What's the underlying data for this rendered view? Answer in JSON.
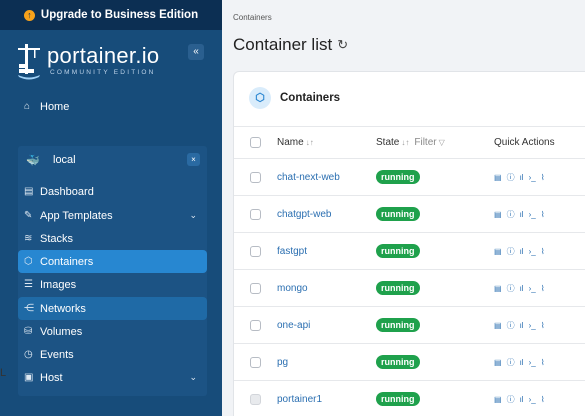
{
  "upgrade": {
    "label": "Upgrade to Business Edition"
  },
  "logo": {
    "name": "portainer.io",
    "edition": "COMMUNITY EDITION"
  },
  "sidebar": {
    "collapse": "«",
    "home": "Home",
    "environment": {
      "name": "local",
      "close": "×"
    },
    "items": [
      {
        "label": "Dashboard",
        "icon": "dashboard-icon"
      },
      {
        "label": "App Templates",
        "icon": "edit-icon"
      },
      {
        "label": "Stacks",
        "icon": "stacks-icon"
      },
      {
        "label": "Containers",
        "icon": "box-icon"
      },
      {
        "label": "Images",
        "icon": "list-icon"
      },
      {
        "label": "Networks",
        "icon": "network-icon"
      },
      {
        "label": "Volumes",
        "icon": "database-icon"
      },
      {
        "label": "Events",
        "icon": "clock-icon"
      },
      {
        "label": "Host",
        "icon": "server-icon"
      }
    ]
  },
  "breadcrumb": "Containers",
  "page_title": "Container list",
  "panel": {
    "title": "Containers",
    "columns": {
      "name": "Name",
      "state": "State",
      "filter": "Filter",
      "actions": "Quick Actions"
    },
    "rows": [
      {
        "name": "chat-next-web",
        "state": "running"
      },
      {
        "name": "chatgpt-web",
        "state": "running"
      },
      {
        "name": "fastgpt",
        "state": "running"
      },
      {
        "name": "mongo",
        "state": "running"
      },
      {
        "name": "one-api",
        "state": "running"
      },
      {
        "name": "pg",
        "state": "running"
      },
      {
        "name": "portainer1",
        "state": "running"
      }
    ]
  },
  "footer_fragment": "L",
  "colors": {
    "sidebar": "#174c7a",
    "active": "#2787d1",
    "running": "#1fa14c",
    "link": "#2b6fb1"
  }
}
